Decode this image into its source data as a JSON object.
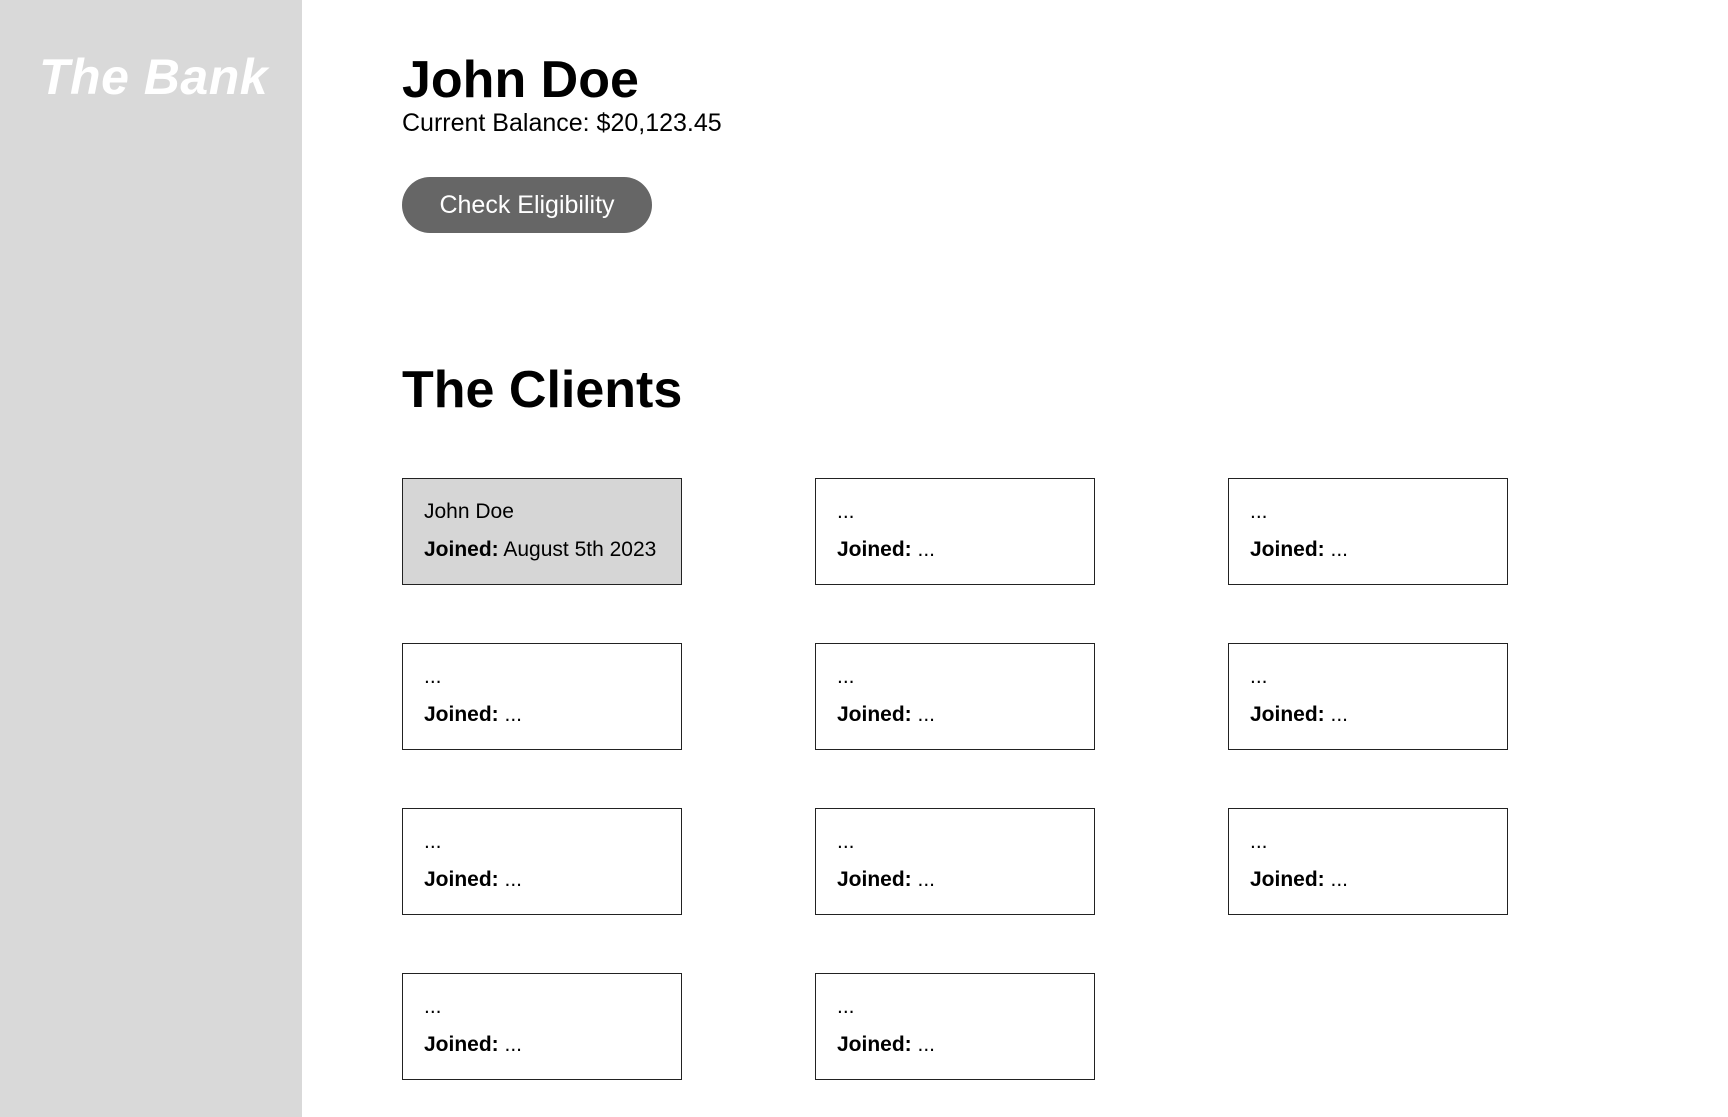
{
  "app": {
    "brand": "The Bank"
  },
  "account": {
    "name": "John Doe",
    "balance_text": "Current Balance: $20,123.45",
    "check_button_label": "Check Eligibility"
  },
  "clients": {
    "heading": "The Clients",
    "joined_label": "Joined:",
    "items": [
      {
        "name": "John Doe",
        "joined": "August 5th 2023",
        "selected": true
      },
      {
        "name": "...",
        "joined": "...",
        "selected": false
      },
      {
        "name": "...",
        "joined": "...",
        "selected": false
      },
      {
        "name": "...",
        "joined": "...",
        "selected": false
      },
      {
        "name": "...",
        "joined": "...",
        "selected": false
      },
      {
        "name": "...",
        "joined": "...",
        "selected": false
      },
      {
        "name": "...",
        "joined": "...",
        "selected": false
      },
      {
        "name": "...",
        "joined": "...",
        "selected": false
      },
      {
        "name": "...",
        "joined": "...",
        "selected": false
      },
      {
        "name": "...",
        "joined": "...",
        "selected": false
      },
      {
        "name": "...",
        "joined": "...",
        "selected": false
      }
    ]
  },
  "colors": {
    "sidebar_bg": "#d9d9d9",
    "button_bg": "#666666",
    "selected_card_bg": "#d6d6d6",
    "card_border": "#222222"
  }
}
